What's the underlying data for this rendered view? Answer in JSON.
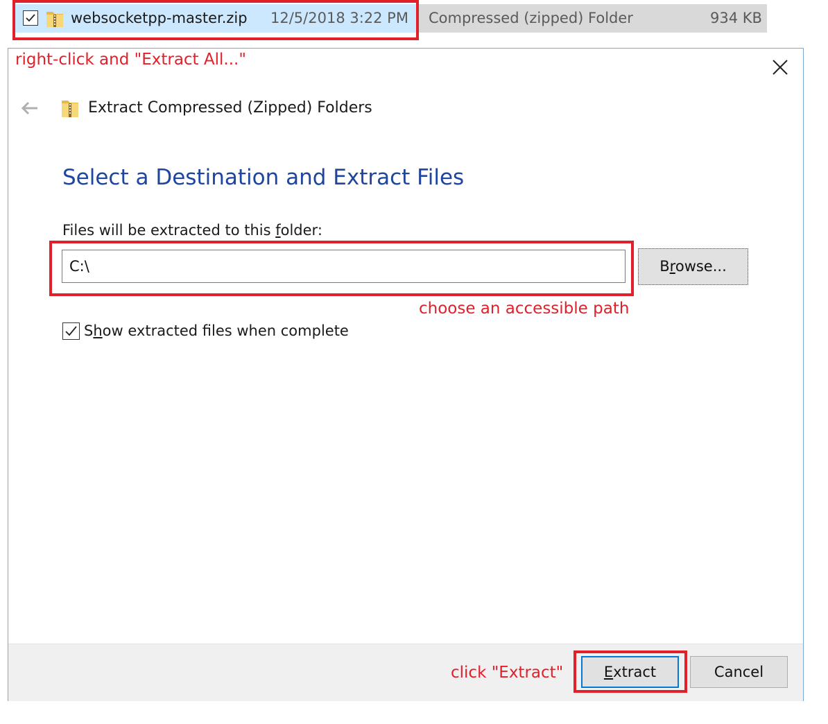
{
  "explorer_row": {
    "checked": true,
    "file_name": "websocketpp-master.zip",
    "date_modified": "12/5/2018 3:22 PM",
    "type": "Compressed (zipped) Folder",
    "size": "934 KB"
  },
  "annotations": {
    "step1": "right-click and \"Extract All...\"",
    "step2": "choose an accessible path",
    "step3": "click \"Extract\""
  },
  "dialog": {
    "window_title": "Extract Compressed (Zipped) Folders",
    "heading": "Select a Destination and Extract Files",
    "folder_label_prefix": "Files will be extracted to this ",
    "folder_label_access": "f",
    "folder_label_rest": "older:",
    "destination_path": "C:\\",
    "browse_label_pre": "B",
    "browse_label_access": "r",
    "browse_label_post": "owse...",
    "show_files_checked": true,
    "show_files_pre": "S",
    "show_files_access": "h",
    "show_files_post": "ow extracted files when complete",
    "extract_access": "E",
    "extract_rest": "xtract",
    "cancel_label": "Cancel"
  },
  "colors": {
    "annotation_red": "#e0202a",
    "heading_blue": "#1e45a0",
    "focus_blue": "#0078d7",
    "row_selected": "#cce8ff",
    "row_background": "#d9d9d9"
  },
  "icons": [
    "checkbox-icon",
    "zip-folder-icon",
    "close-icon",
    "back-arrow-icon"
  ]
}
